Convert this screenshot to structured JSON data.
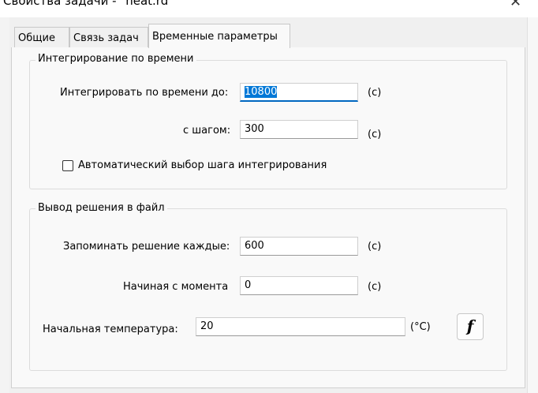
{
  "window": {
    "title": "Свойства задачи - \"heat.rd\"",
    "close_glyph": "✕"
  },
  "tabs": [
    {
      "label": "Общие"
    },
    {
      "label": "Связь задач"
    },
    {
      "label": "Временные параметры",
      "active": true
    }
  ],
  "integration": {
    "legend": "Интегрирование по времени",
    "until_label": "Интегрировать по времени до:",
    "until_value": "10800",
    "until_unit": "(c)",
    "step_label": "с шагом:",
    "step_value": "300",
    "step_unit": "(c)",
    "auto_step_label": "Автоматический выбор шага интегрирования",
    "auto_step_checked": false
  },
  "output": {
    "legend": "Вывод решения в файл",
    "every_label": "Запоминать решение каждые:",
    "every_value": "600",
    "every_unit": "(c)",
    "from_label": "Начиная с момента",
    "from_value": "0",
    "from_unit": "(c)"
  },
  "initial_temperature": {
    "label": "Начальная температура:",
    "value": "20",
    "unit": "(°C)",
    "function_button": "f"
  }
}
